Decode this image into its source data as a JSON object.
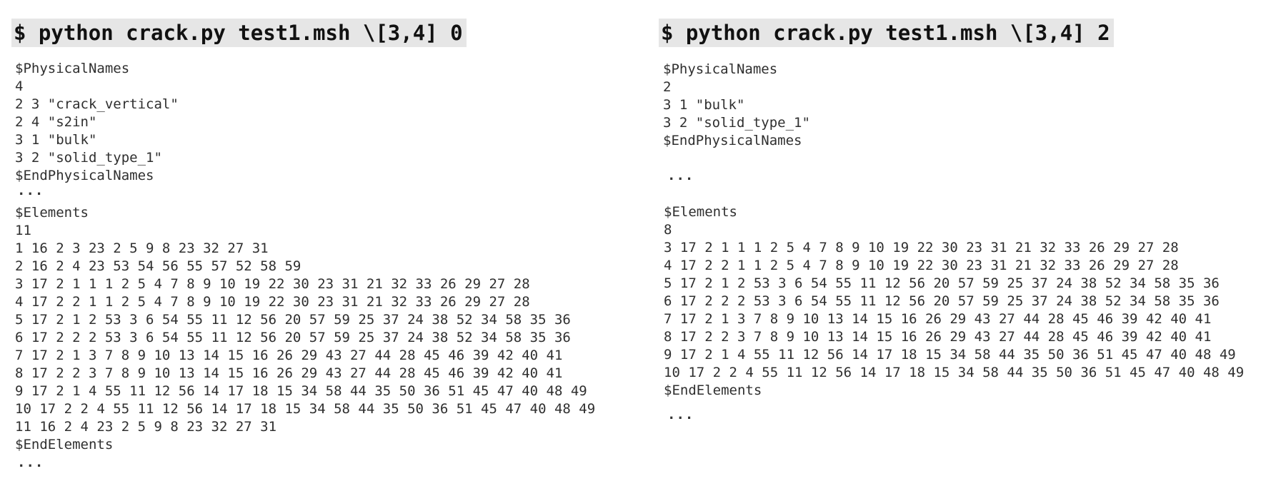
{
  "left": {
    "command": "$ python crack.py test1.msh \\[3,4] 0",
    "physical_names": [
      "$PhysicalNames",
      "4",
      "2 3 \"crack_vertical\"",
      "2 4 \"s2in\"",
      "3 1 \"bulk\"",
      "3 2 \"solid_type_1\"",
      "$EndPhysicalNames"
    ],
    "ellipsis_1": "...",
    "elements": [
      "$Elements",
      "11",
      "1 16 2 3 23 2 5 9 8 23 32 27 31",
      "2 16 2 4 23 53 54 56 55 57 52 58 59",
      "3 17 2 1 1 1 2 5 4 7 8 9 10 19 22 30 23 31 21 32 33 26 29 27 28",
      "4 17 2 2 1 1 2 5 4 7 8 9 10 19 22 30 23 31 21 32 33 26 29 27 28",
      "5 17 2 1 2 53 3 6 54 55 11 12 56 20 57 59 25 37 24 38 52 34 58 35 36",
      "6 17 2 2 2 53 3 6 54 55 11 12 56 20 57 59 25 37 24 38 52 34 58 35 36",
      "7 17 2 1 3 7 8 9 10 13 14 15 16 26 29 43 27 44 28 45 46 39 42 40 41",
      "8 17 2 2 3 7 8 9 10 13 14 15 16 26 29 43 27 44 28 45 46 39 42 40 41",
      "9 17 2 1 4 55 11 12 56 14 17 18 15 34 58 44 35 50 36 51 45 47 40 48 49",
      "10 17 2 2 4 55 11 12 56 14 17 18 15 34 58 44 35 50 36 51 45 47 40 48 49",
      "11 16 2 4 23 2 5 9 8 23 32 27 31",
      "$EndElements"
    ],
    "ellipsis_2": "..."
  },
  "right": {
    "command": "$ python crack.py test1.msh \\[3,4] 2",
    "physical_names": [
      "$PhysicalNames",
      "2",
      "3 1 \"bulk\"",
      "3 2 \"solid_type_1\"",
      "$EndPhysicalNames"
    ],
    "ellipsis_1": "...",
    "elements": [
      "$Elements",
      "8",
      "3 17 2 1 1 1 2 5 4 7 8 9 10 19 22 30 23 31 21 32 33 26 29 27 28",
      "4 17 2 2 1 1 2 5 4 7 8 9 10 19 22 30 23 31 21 32 33 26 29 27 28",
      "5 17 2 1 2 53 3 6 54 55 11 12 56 20 57 59 25 37 24 38 52 34 58 35 36",
      "6 17 2 2 2 53 3 6 54 55 11 12 56 20 57 59 25 37 24 38 52 34 58 35 36",
      "7 17 2 1 3 7 8 9 10 13 14 15 16 26 29 43 27 44 28 45 46 39 42 40 41",
      "8 17 2 2 3 7 8 9 10 13 14 15 16 26 29 43 27 44 28 45 46 39 42 40 41",
      "9 17 2 1 4 55 11 12 56 14 17 18 15 34 58 44 35 50 36 51 45 47 40 48 49",
      "10 17 2 2 4 55 11 12 56 14 17 18 15 34 58 44 35 50 36 51 45 47 40 48 49",
      "$EndElements"
    ],
    "ellipsis_2": "..."
  },
  "colors": {
    "command_background": "#e6e6e6",
    "command_text": "#111111",
    "body_text": "#2f2f2f",
    "page_background": "#ffffff"
  }
}
